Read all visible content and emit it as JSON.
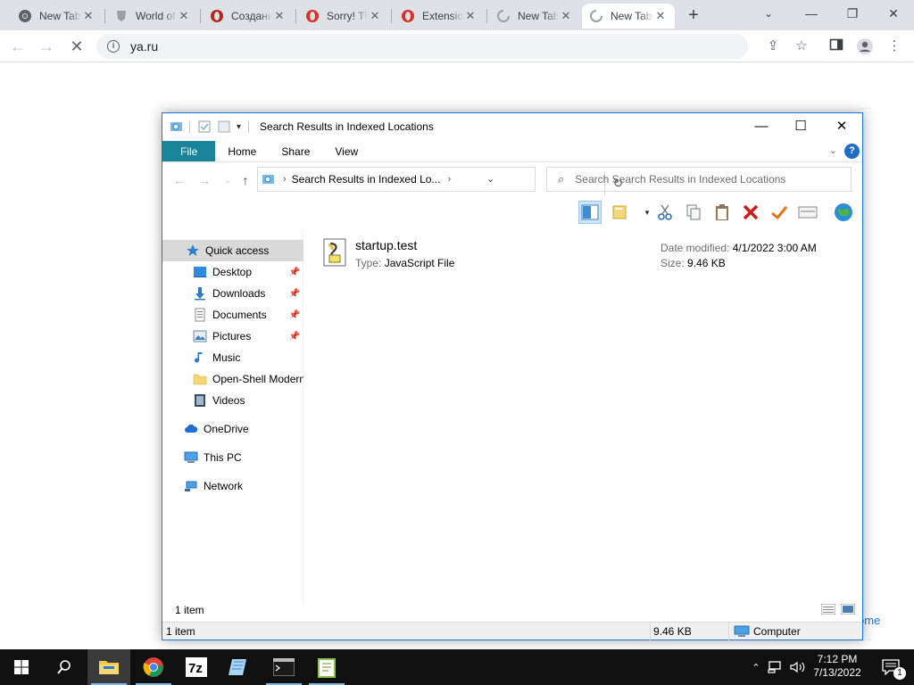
{
  "browser": {
    "tabs": [
      {
        "title": "New Tab",
        "icon": "chrome-icon"
      },
      {
        "title": "World of Tanks",
        "icon": "wot-icon"
      },
      {
        "title": "Создание",
        "icon": "opera-icon"
      },
      {
        "title": "Sorry! This",
        "icon": "opera-icon"
      },
      {
        "title": "Extensions",
        "icon": "opera-icon"
      },
      {
        "title": "New Tab",
        "icon": "loading-icon"
      },
      {
        "title": "New Tab",
        "icon": "loading-icon"
      }
    ],
    "address": "ya.ru",
    "page_link": "ome"
  },
  "explorer": {
    "title": "Search Results in Indexed Locations",
    "ribbon_tabs": [
      "File",
      "Home",
      "Share",
      "View"
    ],
    "address_crumb": "Search Results in Indexed Lo...",
    "search_placeholder": "Search Search Results in Indexed Locations",
    "nav": {
      "quick_access": "Quick access",
      "items": [
        {
          "label": "Desktop",
          "pinned": true
        },
        {
          "label": "Downloads",
          "pinned": true
        },
        {
          "label": "Documents",
          "pinned": true
        },
        {
          "label": "Pictures",
          "pinned": true
        },
        {
          "label": "Music",
          "pinned": false
        },
        {
          "label": "Open-Shell Modern",
          "pinned": false
        },
        {
          "label": "Videos",
          "pinned": false
        }
      ],
      "onedrive": "OneDrive",
      "this_pc": "This PC",
      "network": "Network"
    },
    "file": {
      "name": "startup.test",
      "type_label": "Type:",
      "type": "JavaScript File",
      "date_label": "Date modified:",
      "date": "4/1/2022 3:00 AM",
      "size_label": "Size:",
      "size": "9.46 KB"
    },
    "item_count": "1 item",
    "status": {
      "items": "1 item",
      "size": "9.46 KB",
      "location": "Computer"
    }
  },
  "taskbar": {
    "apps": [
      "start",
      "search",
      "file-explorer",
      "chrome",
      "7zip",
      "notepad",
      "terminal",
      "notepad-plus"
    ],
    "time": "7:12 PM",
    "date": "7/13/2022",
    "notification_count": "1"
  },
  "colors": {
    "file_tab": "#19849a",
    "chrome_tabstrip": "#dee1e6",
    "taskbar": "#101010",
    "accent": "#1a73e8"
  }
}
